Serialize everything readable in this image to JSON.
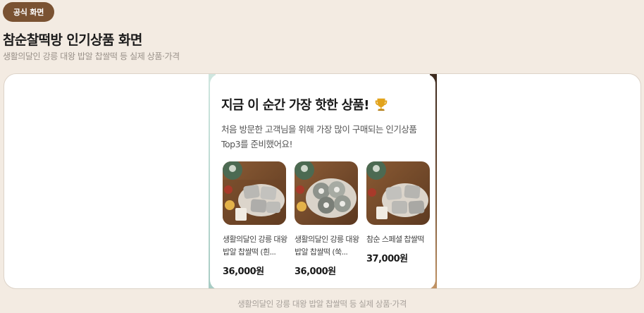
{
  "badge": {
    "label": "공식 화면"
  },
  "header": {
    "title": "참순찰떡방 인기상품 화면",
    "subtitle": "생활의달인 강릉 대왕 밥알 찹쌀떡 등 실제 상품·가격"
  },
  "popup": {
    "title": "지금 이 순간 가장 핫한 상품!",
    "title_icon": "trophy-icon",
    "description_line1": "처음 방문한 고객님을 위해 가장 많이 구매되는 인기상품",
    "description_line2": "Top3를 준비했어요!"
  },
  "products": [
    {
      "name": "생활의달인 강릉 대왕 밥알 찹쌀떡 (흰...",
      "price": "36,000원"
    },
    {
      "name": "생활의달인 강릉 대왕 밥알 찹쌀떡 (쑥...",
      "price": "36,000원"
    },
    {
      "name": "참순 스페셜 찹쌀떡",
      "price": "37,000원"
    }
  ],
  "footer": {
    "caption": "생활의달인 강릉 대왕 밥알 찹쌀떡 등 실제 상품·가격"
  },
  "colors": {
    "page_bg": "#f3ebe2",
    "badge_bg": "#7a5232",
    "frame_bg": "#ffffff",
    "trophy": "#e2a31b"
  }
}
